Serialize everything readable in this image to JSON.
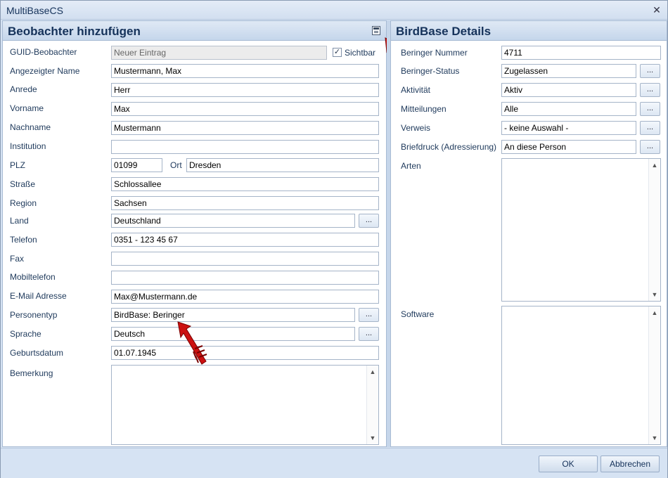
{
  "window": {
    "title": "MultiBaseCS",
    "close_label": "✕"
  },
  "left": {
    "header": "Beobachter hinzufügen",
    "header_icon": "layout-icon",
    "fields": {
      "guid": {
        "label": "GUID-Beobachter",
        "value": "Neuer Eintrag"
      },
      "sichtbar": {
        "label": "Sichtbar",
        "checked": true,
        "check": "✓"
      },
      "display_name": {
        "label": "Angezeigter Name",
        "value": "Mustermann, Max"
      },
      "anrede": {
        "label": "Anrede",
        "value": "Herr"
      },
      "vorname": {
        "label": "Vorname",
        "value": "Max"
      },
      "nachname": {
        "label": "Nachname",
        "value": "Mustermann"
      },
      "institution": {
        "label": "Institution",
        "value": ""
      },
      "plz": {
        "label": "PLZ",
        "value": "01099"
      },
      "ort": {
        "label": "Ort",
        "value": "Dresden"
      },
      "strasse": {
        "label": "Straße",
        "value": "Schlossallee"
      },
      "region": {
        "label": "Region",
        "value": "Sachsen"
      },
      "land": {
        "label": "Land",
        "value": "Deutschland"
      },
      "telefon": {
        "label": "Telefon",
        "value": "0351 - 123 45 67"
      },
      "fax": {
        "label": "Fax",
        "value": ""
      },
      "mobil": {
        "label": "Mobiltelefon",
        "value": ""
      },
      "email": {
        "label": "E-Mail Adresse",
        "value": "Max@Mustermann.de"
      },
      "personentyp": {
        "label": "Personentyp",
        "value": "BirdBase: Beringer"
      },
      "sprache": {
        "label": "Sprache",
        "value": "Deutsch"
      },
      "geburtsdatum": {
        "label": "Geburtsdatum",
        "value": "01.07.1945"
      },
      "bemerkung": {
        "label": "Bemerkung",
        "value": ""
      }
    }
  },
  "right": {
    "header": "BirdBase Details",
    "fields": {
      "beringer_nummer": {
        "label": "Beringer Nummer",
        "value": "4711"
      },
      "beringer_status": {
        "label": "Beringer-Status",
        "value": "Zugelassen"
      },
      "aktivitaet": {
        "label": "Aktivität",
        "value": "Aktiv"
      },
      "mitteilungen": {
        "label": "Mitteilungen",
        "value": "Alle"
      },
      "verweis": {
        "label": "Verweis",
        "value": "- keine Auswahl -"
      },
      "briefdruck": {
        "label": "Briefdruck (Adressierung)",
        "value": "An diese Person"
      },
      "arten": {
        "label": "Arten"
      },
      "software": {
        "label": "Software"
      }
    }
  },
  "common": {
    "ellipsis": "...",
    "scroll_up": "▲",
    "scroll_down": "▼"
  },
  "footer": {
    "ok_label": "OK",
    "cancel_label": "Abbrechen"
  },
  "colors": {
    "arrow": "#cc1111",
    "accent": "#15325a"
  }
}
